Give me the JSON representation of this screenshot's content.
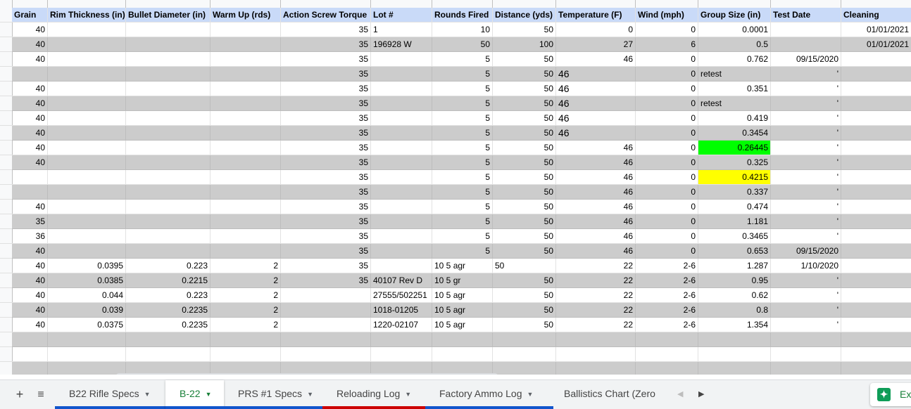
{
  "columns": [
    {
      "header": "Grain",
      "align": "r"
    },
    {
      "header": "Rim Thickness (in)",
      "align": "r"
    },
    {
      "header": "Bullet Diameter (in)",
      "align": "r"
    },
    {
      "header": "Warm Up (rds)",
      "align": "r"
    },
    {
      "header": "Action Screw Torque",
      "align": "r"
    },
    {
      "header": "Lot #",
      "align": "l"
    },
    {
      "header": "Rounds Fired",
      "align": "r"
    },
    {
      "header": "Distance (yds)",
      "align": "r"
    },
    {
      "header": "Temperature (F)",
      "align": "r"
    },
    {
      "header": "Wind (mph)",
      "align": "r"
    },
    {
      "header": "Group Size (in)",
      "align": "r"
    },
    {
      "header": "Test Date",
      "align": "r"
    },
    {
      "header": "Cleaning",
      "align": "r"
    }
  ],
  "rows": [
    {
      "style": "w",
      "cells": [
        "40",
        "",
        "",
        "",
        "35",
        "1",
        "10",
        "50",
        "0",
        "0",
        "0.0001",
        "",
        "01/01/2021"
      ]
    },
    {
      "style": "g",
      "cells": [
        "40",
        "",
        "",
        "",
        "35",
        "196928 W",
        "50",
        "100",
        "27",
        "6",
        "0.5",
        "",
        "01/01/2021"
      ]
    },
    {
      "style": "w",
      "cells": [
        "40",
        "",
        "",
        "",
        "35",
        "",
        "5",
        "50",
        "46",
        "0",
        "0.762",
        "09/15/2020",
        ""
      ]
    },
    {
      "style": "g",
      "cells": [
        "",
        "",
        "",
        "",
        "35",
        "",
        "5",
        "50",
        "46",
        "0",
        "retest",
        "'",
        ""
      ],
      "left": [
        8,
        10
      ],
      "big": [
        8
      ]
    },
    {
      "style": "w",
      "cells": [
        "40",
        "",
        "",
        "",
        "35",
        "",
        "5",
        "50",
        "46",
        "0",
        "0.351",
        "'",
        ""
      ],
      "left": [
        8
      ],
      "big": [
        8
      ]
    },
    {
      "style": "g",
      "cells": [
        "40",
        "",
        "",
        "",
        "35",
        "",
        "5",
        "50",
        "46",
        "0",
        "retest",
        "'",
        ""
      ],
      "left": [
        8,
        10
      ],
      "big": [
        8
      ]
    },
    {
      "style": "w",
      "cells": [
        "40",
        "",
        "",
        "",
        "35",
        "",
        "5",
        "50",
        "46",
        "0",
        "0.419",
        "'",
        ""
      ],
      "left": [
        8
      ],
      "big": [
        8
      ]
    },
    {
      "style": "g",
      "cells": [
        "40",
        "",
        "",
        "",
        "35",
        "",
        "5",
        "50",
        "46",
        "0",
        "0.3454",
        "'",
        ""
      ],
      "left": [
        8
      ],
      "big": [
        8
      ]
    },
    {
      "style": "w",
      "cells": [
        "40",
        "",
        "",
        "",
        "35",
        "",
        "5",
        "50",
        "46",
        "0",
        "0.26445",
        "'",
        ""
      ],
      "hl": {
        "10": "green"
      }
    },
    {
      "style": "g",
      "cells": [
        "40",
        "",
        "",
        "",
        "35",
        "",
        "5",
        "50",
        "46",
        "0",
        "0.325",
        "'",
        ""
      ]
    },
    {
      "style": "w",
      "cells": [
        "",
        "",
        "",
        "",
        "35",
        "",
        "5",
        "50",
        "46",
        "0",
        "0.4215",
        "'",
        ""
      ],
      "hl": {
        "10": "yellow"
      }
    },
    {
      "style": "g",
      "cells": [
        "",
        "",
        "",
        "",
        "35",
        "",
        "5",
        "50",
        "46",
        "0",
        "0.337",
        "'",
        ""
      ]
    },
    {
      "style": "w",
      "cells": [
        "40",
        "",
        "",
        "",
        "35",
        "",
        "5",
        "50",
        "46",
        "0",
        "0.474",
        "'",
        ""
      ]
    },
    {
      "style": "g",
      "cells": [
        "35",
        "",
        "",
        "",
        "35",
        "",
        "5",
        "50",
        "46",
        "0",
        "1.181",
        "'",
        ""
      ]
    },
    {
      "style": "w",
      "cells": [
        "36",
        "",
        "",
        "",
        "35",
        "",
        "5",
        "50",
        "46",
        "0",
        "0.3465",
        "'",
        ""
      ]
    },
    {
      "style": "g",
      "cells": [
        "40",
        "",
        "",
        "",
        "35",
        "",
        "5",
        "50",
        "46",
        "0",
        "0.653",
        "09/15/2020",
        ""
      ]
    },
    {
      "style": "w",
      "cells": [
        "40",
        "0.0395",
        "0.223",
        "2",
        "35",
        "",
        "10 5 agr",
        "50",
        "22",
        "2-6",
        "1.287",
        "1/10/2020",
        ""
      ],
      "left": [
        6,
        7
      ]
    },
    {
      "style": "g",
      "cells": [
        "40",
        "0.0385",
        "0.2215",
        "2",
        "35",
        "40107 Rev D",
        "10 5 gr",
        "50",
        "22",
        "2-6",
        "0.95",
        "'",
        ""
      ],
      "left": [
        6
      ]
    },
    {
      "style": "w",
      "cells": [
        "40",
        "0.044",
        "0.223",
        "2",
        "",
        "27555/502251",
        "10 5 agr",
        "50",
        "22",
        "2-6",
        "0.62",
        "'",
        ""
      ],
      "left": [
        6
      ]
    },
    {
      "style": "g",
      "cells": [
        "40",
        "0.039",
        "0.2235",
        "2",
        "",
        "1018-01205",
        "10 5 agr",
        "50",
        "22",
        "2-6",
        "0.8",
        "'",
        ""
      ],
      "left": [
        6
      ]
    },
    {
      "style": "w",
      "cells": [
        "40",
        "0.0375",
        "0.2235",
        "2",
        "",
        "1220-02107",
        "10 5 agr",
        "50",
        "22",
        "2-6",
        "1.354",
        "'",
        ""
      ],
      "left": [
        6
      ]
    },
    {
      "style": "g",
      "cells": [
        "",
        "",
        "",
        "",
        "",
        "",
        "",
        "",
        "",
        "",
        "",
        "",
        ""
      ]
    },
    {
      "style": "w",
      "cells": [
        "",
        "",
        "",
        "",
        "",
        "",
        "",
        "",
        "",
        "",
        "",
        "",
        ""
      ]
    },
    {
      "style": "g",
      "cells": [
        "",
        "",
        "",
        "",
        "",
        "",
        "",
        "",
        "",
        "",
        "",
        "",
        ""
      ]
    }
  ],
  "colors": {
    "header_bg": "#c9daf8",
    "row_gray": "#cccccc",
    "highlight_green": "#00ff00",
    "highlight_yellow": "#ffff00",
    "active_tab": "#188038"
  },
  "toolbar": {
    "add_label": "+",
    "list_label": "≡"
  },
  "tabs": [
    {
      "label": "B22 Rifle Specs",
      "active": false,
      "color": "#1155cc",
      "arrow": "▼"
    },
    {
      "label": "B-22",
      "active": true,
      "color": "#1155cc",
      "arrow": "▼"
    },
    {
      "label": "PRS #1 Specs",
      "active": false,
      "color": "#1155cc",
      "arrow": "▼"
    },
    {
      "label": "Reloading Log",
      "active": false,
      "color": "#cc0000",
      "arrow": "▼"
    },
    {
      "label": "Factory Ammo Log",
      "active": false,
      "color": "#1155cc",
      "arrow": "▼"
    },
    {
      "label": "Ballistics Chart (Zero",
      "active": false,
      "color": "",
      "arrow": ""
    }
  ],
  "nav": {
    "prev": "◀",
    "next": "▶"
  },
  "explore": {
    "label": "Explore",
    "icon": "explore-icon"
  }
}
